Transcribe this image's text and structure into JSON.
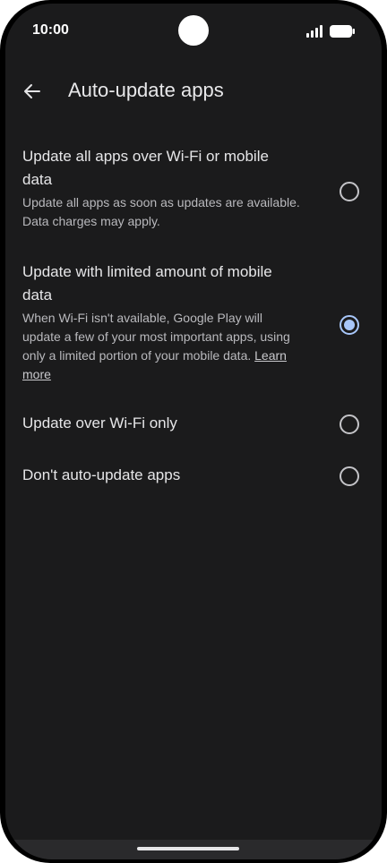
{
  "status_bar": {
    "time": "10:00"
  },
  "app_bar": {
    "title": "Auto-update apps"
  },
  "options": [
    {
      "title": "Update all apps over Wi-Fi or mobile data",
      "description": "Update all apps as soon as updates are available. Data charges may apply.",
      "selected": false
    },
    {
      "title": "Update with limited amount of mobile data",
      "description": "When Wi-Fi isn't available, Google Play will update a few of your most important apps, using only a limited portion of your mobile data.",
      "link": "Learn more",
      "selected": true
    },
    {
      "title": "Update over Wi-Fi only",
      "selected": false
    },
    {
      "title": "Don't auto-update apps",
      "selected": false
    }
  ],
  "colors": {
    "background": "#1b1b1c",
    "accent": "#a8c7fa"
  }
}
